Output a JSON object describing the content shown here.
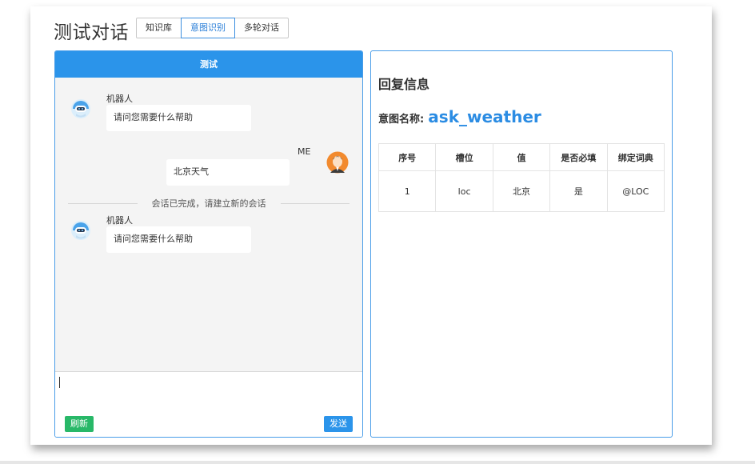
{
  "header": {
    "title": "测试对话",
    "tabs": [
      {
        "label": "知识库",
        "active": false
      },
      {
        "label": "意图识别",
        "active": true
      },
      {
        "label": "多轮对话",
        "active": false
      }
    ]
  },
  "chat": {
    "header_title": "测试",
    "messages": [
      {
        "sender": "机器人",
        "text": "请问您需要什么帮助",
        "avatar": "robot-icon"
      },
      {
        "sender": "ME",
        "text": "北京天气",
        "avatar": "user-icon"
      },
      {
        "sender": "机器人",
        "text": "请问您需要什么帮助",
        "avatar": "robot-icon"
      }
    ],
    "divider_text": "会话已完成，请建立新的会话",
    "input_value": "",
    "refresh_label": "刷新",
    "send_label": "发送"
  },
  "reply": {
    "title": "回复信息",
    "intent_label": "意图名称:",
    "intent_value": "ask_weather",
    "table": {
      "headers": [
        "序号",
        "槽位",
        "值",
        "是否必填",
        "绑定词典"
      ],
      "rows": [
        [
          "1",
          "loc",
          "北京",
          "是",
          "@LOC"
        ]
      ]
    }
  },
  "colors": {
    "accent": "#2b94ea",
    "refresh_button": "#28b868",
    "intent_value": "#2b8ce3",
    "chat_background": "#f4f4f4"
  }
}
